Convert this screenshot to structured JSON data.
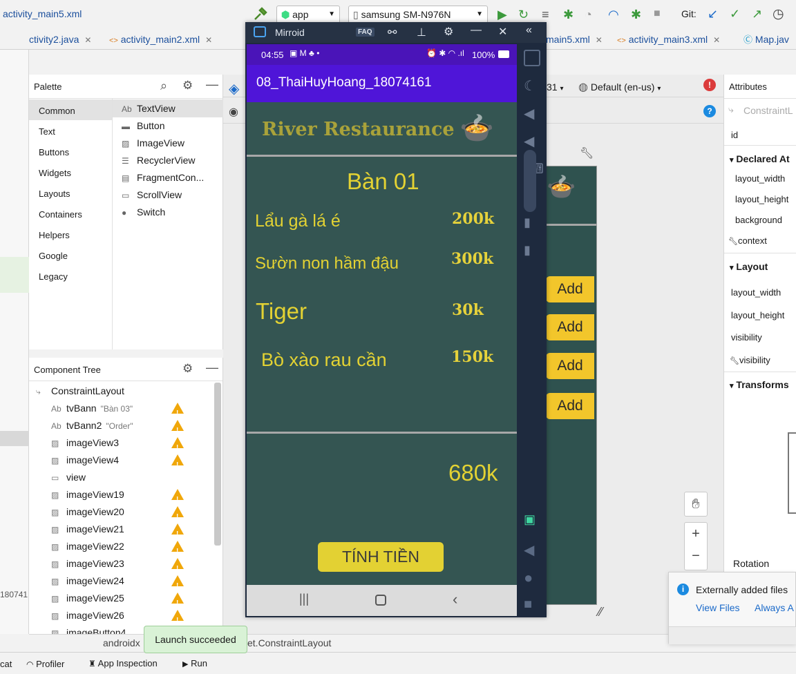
{
  "toolbar": {
    "file_title": "activity_main5.xml",
    "run_config": "app",
    "device": "samsung SM-N976N",
    "git_label": "Git:"
  },
  "tabs": [
    {
      "label": "ctivity2.java"
    },
    {
      "label": "activity_main2.xml"
    },
    {
      "label": "main5.xml"
    },
    {
      "label": "activity_main3.xml"
    },
    {
      "label": "Map.jav"
    }
  ],
  "design_toolbar": {
    "api_level": "31",
    "locale": "Default (en-us)"
  },
  "palette": {
    "title": "Palette",
    "categories": [
      "Common",
      "Text",
      "Buttons",
      "Widgets",
      "Layouts",
      "Containers",
      "Helpers",
      "Google",
      "Legacy"
    ],
    "selected_category": "Common",
    "items": [
      {
        "label": "TextView",
        "icon": "text-ab-icon"
      },
      {
        "label": "Button",
        "icon": "button-icon"
      },
      {
        "label": "ImageView",
        "icon": "image-icon"
      },
      {
        "label": "RecyclerView",
        "icon": "list-icon"
      },
      {
        "label": "FragmentCon...",
        "icon": "fragment-icon"
      },
      {
        "label": "ScrollView",
        "icon": "scroll-icon"
      },
      {
        "label": "Switch",
        "icon": "switch-icon"
      }
    ]
  },
  "component_tree": {
    "title": "Component Tree",
    "root": "ConstraintLayout",
    "items": [
      {
        "name": "tvBann",
        "icon": "Ab",
        "hint": "\"Bàn 03\"",
        "warn": true
      },
      {
        "name": "tvBann2",
        "icon": "Ab",
        "hint": "\"Order\"",
        "warn": true
      },
      {
        "name": "imageView3",
        "icon": "img",
        "hint": "",
        "warn": true
      },
      {
        "name": "imageView4",
        "icon": "img",
        "hint": "",
        "warn": true
      },
      {
        "name": "view",
        "icon": "view",
        "hint": "",
        "warn": false
      },
      {
        "name": "imageView19",
        "icon": "img",
        "hint": "",
        "warn": true
      },
      {
        "name": "imageView20",
        "icon": "img",
        "hint": "",
        "warn": true
      },
      {
        "name": "imageView21",
        "icon": "img",
        "hint": "",
        "warn": true
      },
      {
        "name": "imageView22",
        "icon": "img",
        "hint": "",
        "warn": true
      },
      {
        "name": "imageView23",
        "icon": "img",
        "hint": "",
        "warn": true
      },
      {
        "name": "imageView24",
        "icon": "img",
        "hint": "",
        "warn": true
      },
      {
        "name": "imageView25",
        "icon": "img",
        "hint": "",
        "warn": true
      },
      {
        "name": "imageView26",
        "icon": "img",
        "hint": "",
        "warn": true
      },
      {
        "name": "imageButton4",
        "icon": "img",
        "hint": "",
        "warn": false
      }
    ]
  },
  "attributes": {
    "title": "Attributes",
    "search_placeholder": "ConstraintL",
    "id_label": "id",
    "declared_header": "Declared At",
    "declared": [
      "layout_width",
      "layout_height",
      "background"
    ],
    "context_label": "context",
    "layout_header": "Layout",
    "layout_rows": [
      "layout_width",
      "layout_height",
      "visibility"
    ],
    "layout_tool_row": "visibility",
    "transforms_header": "Transforms",
    "rotation_label": "Rotation"
  },
  "mirroid": {
    "title": "Mirroid",
    "faq": "FAQ",
    "status_time": "04:55",
    "battery": "100%",
    "app_title": "08_ThaiHuyHoang_18074161",
    "restaurant_name": "River Restaurance",
    "table_label": "Bàn 01",
    "menu": [
      {
        "name": "Lẩu gà lá é",
        "price": "200k"
      },
      {
        "name": "Sườn non hầm đậu",
        "price": "300k"
      },
      {
        "name": "Tiger",
        "price": "30k"
      },
      {
        "name": "Bò xào rau cần",
        "price": "150k"
      }
    ],
    "total": "680k",
    "pay_button": "TÍNH TIỀN"
  },
  "blueprint": {
    "add_buttons": [
      "Add",
      "Add",
      "Add",
      "Add"
    ]
  },
  "breadcrumb": {
    "left": "androidx",
    "right": "et.ConstraintLayout"
  },
  "left_edge_text": "180741",
  "toast": "Launch succeeded",
  "notification": {
    "title": "Externally added files",
    "action_view": "View Files",
    "action_always": "Always A"
  },
  "statusbar": {
    "items": [
      "cat",
      "Profiler",
      "App Inspection",
      "Run"
    ]
  },
  "colors": {
    "app_bg": "#345552",
    "accent_yellow": "#e3d233",
    "button_yellow": "#e3d133",
    "app_bar": "#4f15d8",
    "status_bar": "#4a14b8"
  }
}
